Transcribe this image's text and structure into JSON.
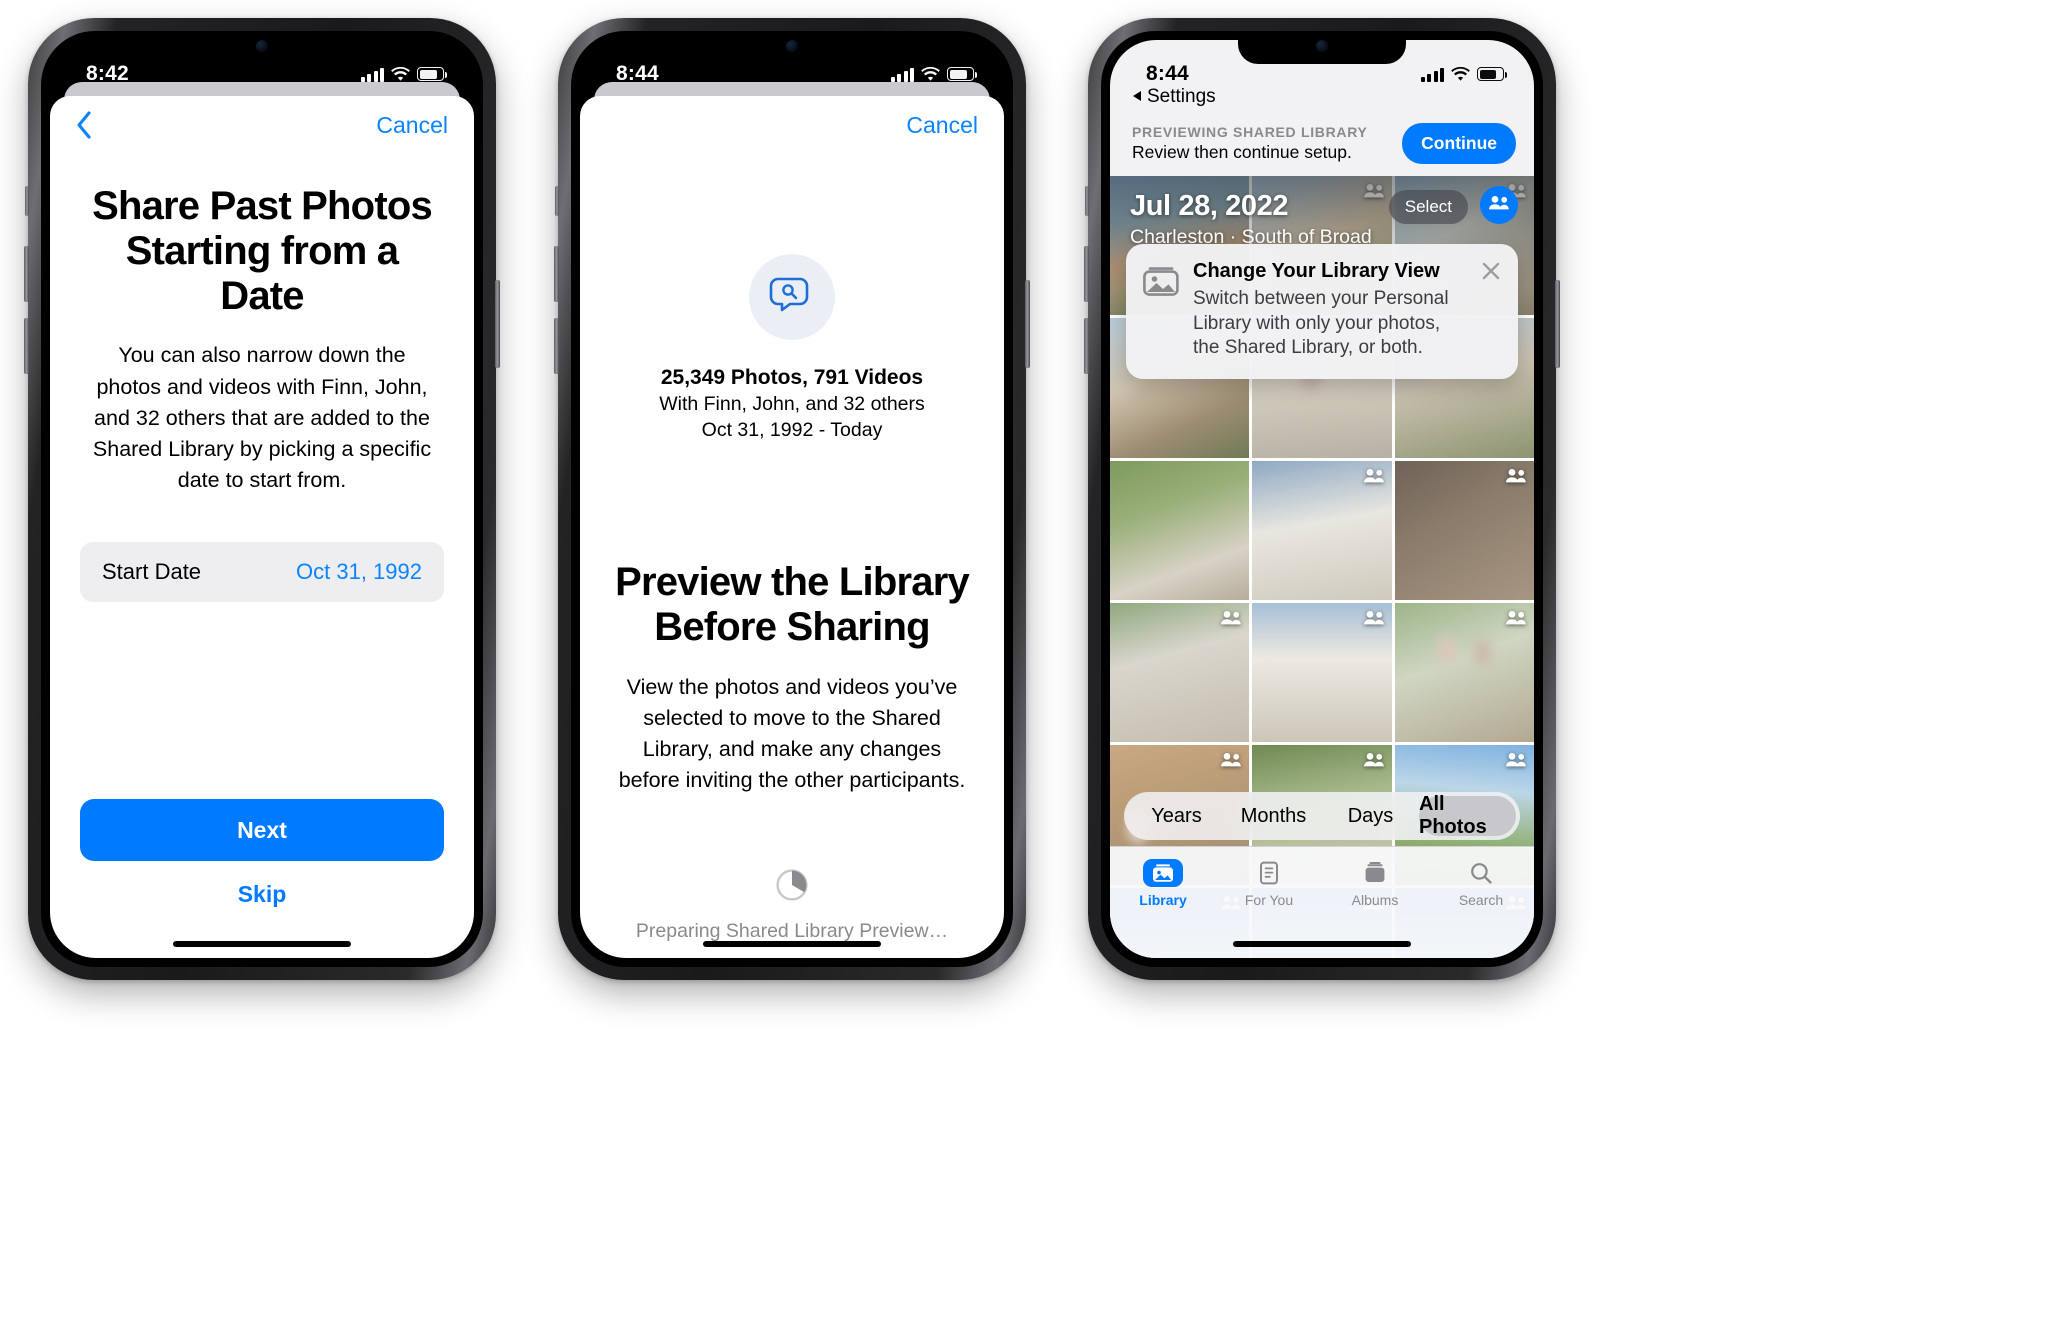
{
  "phone1": {
    "status": {
      "time": "8:42",
      "signal_icon": "cellular-bars-icon",
      "wifi_icon": "wifi-icon",
      "battery_icon": "battery-icon"
    },
    "nav": {
      "back_icon": "chevron-left-icon",
      "cancel_label": "Cancel"
    },
    "title": "Share Past Photos Starting from a Date",
    "description": "You can also narrow down the photos and videos with Finn, John, and 32 others that are added to the Shared Library by picking a specific date to start from.",
    "date_row": {
      "label": "Start Date",
      "value": "Oct 31, 1992"
    },
    "primary_button": "Next",
    "secondary_button": "Skip"
  },
  "phone2": {
    "status": {
      "time": "8:44",
      "signal_icon": "cellular-bars-icon",
      "wifi_icon": "wifi-icon",
      "battery_icon": "battery-icon"
    },
    "nav": {
      "cancel_label": "Cancel"
    },
    "hero_icon": "shared-library-message-icon",
    "stats": {
      "counts": "25,349 Photos, 791 Videos",
      "participants": "With Finn, John, and 32 others",
      "date_range": "Oct 31, 1992 - Today"
    },
    "title": "Preview the Library Before Sharing",
    "description": "View the photos and videos you’ve selected to move to the Shared Library, and make any changes before inviting the other participants.",
    "progress_icon": "progress-spinner-icon",
    "progress_label": "Preparing Shared Library Preview…"
  },
  "phone3": {
    "status": {
      "time": "8:44",
      "signal_icon": "cellular-bars-icon",
      "wifi_icon": "wifi-icon",
      "battery_icon": "battery-icon"
    },
    "back_link": {
      "icon": "triangle-left-icon",
      "label": "Settings"
    },
    "banner": {
      "eyebrow": "PREVIEWING SHARED LIBRARY",
      "subtitle": "Review then continue setup.",
      "action_label": "Continue"
    },
    "hero": {
      "date": "Jul 28, 2022",
      "location": "Charleston · South of Broad",
      "select_label": "Select",
      "library_toggle_icon": "two-people-icon"
    },
    "tooltip": {
      "icon": "photo-library-icon",
      "title": "Change Your Library View",
      "body": "Switch between your Personal Library with only your photos, the Shared Library, or both.",
      "close_icon": "close-x-icon"
    },
    "segments": [
      {
        "label": "Years",
        "active": false
      },
      {
        "label": "Months",
        "active": false
      },
      {
        "label": "Days",
        "active": false
      },
      {
        "label": "All Photos",
        "active": true
      }
    ],
    "tabs": [
      {
        "label": "Library",
        "icon": "photo-library-icon",
        "active": true
      },
      {
        "label": "For You",
        "icon": "for-you-icon",
        "active": false
      },
      {
        "label": "Albums",
        "icon": "albums-icon",
        "active": false
      },
      {
        "label": "Search",
        "icon": "search-icon",
        "active": false
      }
    ],
    "grid_badge_icon": "two-people-badge-icon",
    "photo_count_visible": 18
  },
  "colors": {
    "accent_blue": "#007AFF",
    "link_blue": "#0A84FF",
    "sheet_gray": "#EEEEF1",
    "secondary_text": "#8A8A8E",
    "segment_active": "#C7C7CC"
  }
}
